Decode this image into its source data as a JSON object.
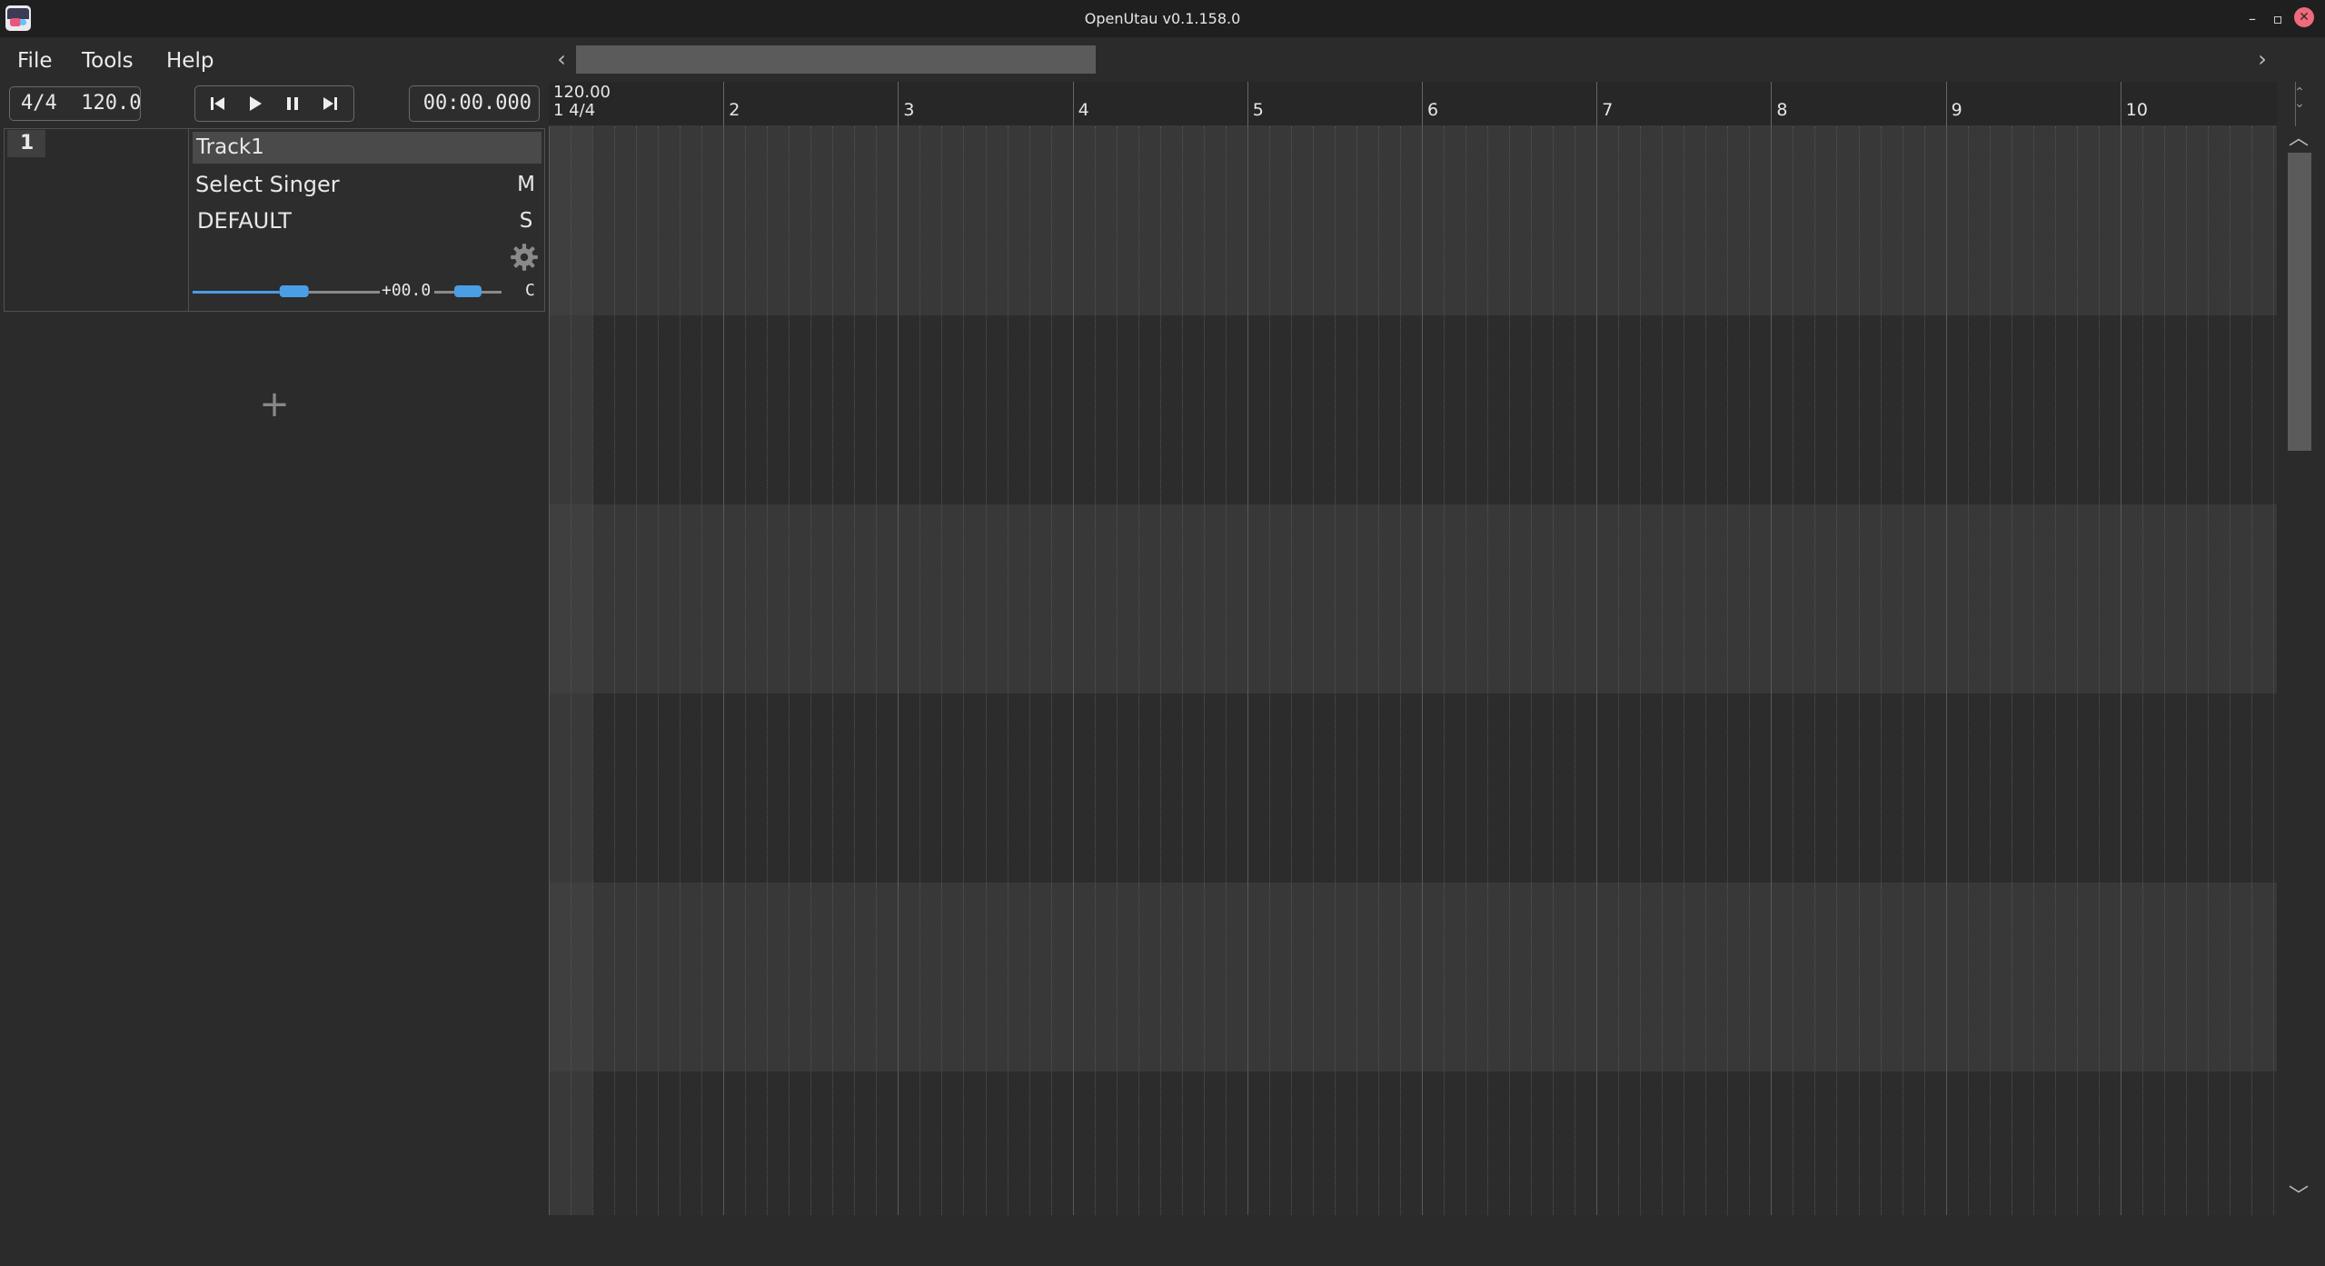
{
  "window": {
    "title": "OpenUtau v0.1.158.0",
    "minimize": "–",
    "maximize": "▫",
    "close": "✕"
  },
  "menu": [
    {
      "label": "File"
    },
    {
      "label": "Tools"
    },
    {
      "label": "Help"
    }
  ],
  "toolbar": {
    "time_signature": "4/4",
    "tempo": "120.00",
    "position": "00:00.000",
    "transport": [
      {
        "name": "skip-to-start"
      },
      {
        "name": "play"
      },
      {
        "name": "pause"
      },
      {
        "name": "skip-to-end"
      }
    ]
  },
  "track": {
    "number": "1",
    "name": "Track1",
    "singer": "Select Singer",
    "phonemizer": "DEFAULT",
    "mute_label": "M",
    "solo_label": "S",
    "volume_value": "+00.0",
    "pan_label": "C",
    "volume_level": 0.55,
    "pan_level": 0.5
  },
  "timeline": {
    "tempo_marker": "120.00",
    "timesig_marker": "1 4/4",
    "bars": [
      "2",
      "3",
      "4",
      "5",
      "6",
      "7",
      "8",
      "9",
      "10"
    ]
  },
  "colors": {
    "accent": "#4a9ee6",
    "background": "#2b2b2b",
    "titlebar": "#1f1f1f",
    "close": "#ef6a7a"
  },
  "icons": {
    "settings": "gear-icon",
    "add": "plus-icon"
  }
}
